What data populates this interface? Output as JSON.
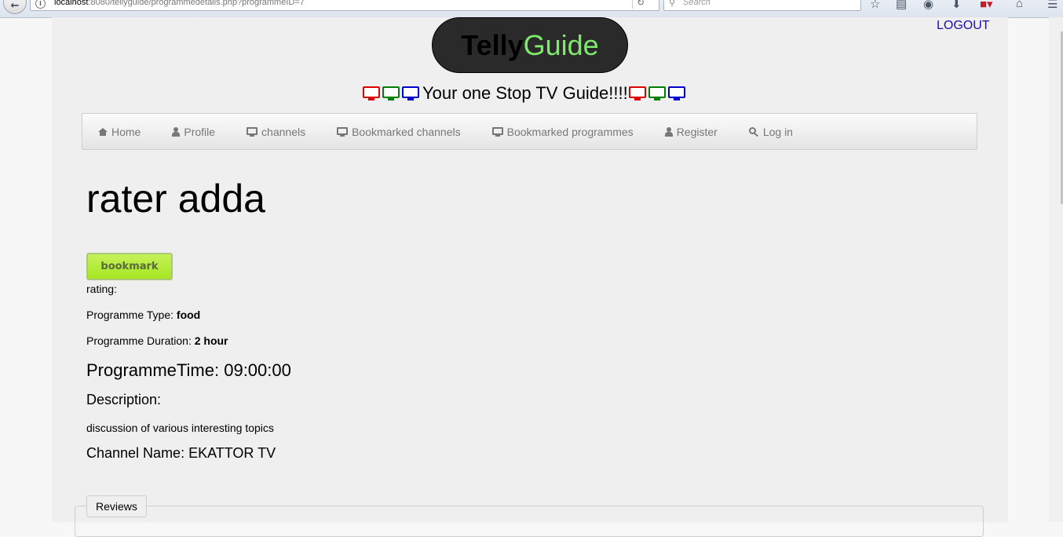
{
  "browser": {
    "url_host": "localhost",
    "url_rest": ":8080/tellyguide/programmedetails.php?programmeID=7",
    "search_placeholder": "Search",
    "reload_icon": "reload-icon",
    "toolbar_icons": [
      "star-icon",
      "reading-list-icon",
      "pocket-icon",
      "download-icon",
      "addon-icon",
      "home-icon",
      "menu-icon"
    ]
  },
  "header": {
    "logo_part1": "Telly",
    "logo_part2": "Guide",
    "logout": "LOGOUT",
    "tagline": "Your one Stop TV Guide!!!!",
    "tv_colors": [
      "#e00000",
      "#008000",
      "#0000cc"
    ]
  },
  "nav": {
    "items": [
      {
        "label": "Home",
        "icon": "home-icon"
      },
      {
        "label": "Profile",
        "icon": "user-icon"
      },
      {
        "label": "channels",
        "icon": "monitor-icon"
      },
      {
        "label": "Bookmarked channels",
        "icon": "monitor-icon"
      },
      {
        "label": "Bookmarked programmes",
        "icon": "monitor-icon"
      },
      {
        "label": "Register",
        "icon": "user-icon"
      },
      {
        "label": "Log in",
        "icon": "key-icon"
      }
    ]
  },
  "programme": {
    "title": "rater adda",
    "bookmark_label": "bookmark",
    "rating_label": "rating:",
    "type_label": "Programme Type: ",
    "type_value": "food",
    "duration_label": "Programme Duration: ",
    "duration_value": "2 hour",
    "time_label": "ProgrammeTime: ",
    "time_value": "09:00:00",
    "description_label": "Description:",
    "description_text": "discussion of various interesting topics",
    "channel_label": "Channel Name: ",
    "channel_value": "EKATTOR TV"
  },
  "reviews": {
    "legend": "Reviews"
  }
}
